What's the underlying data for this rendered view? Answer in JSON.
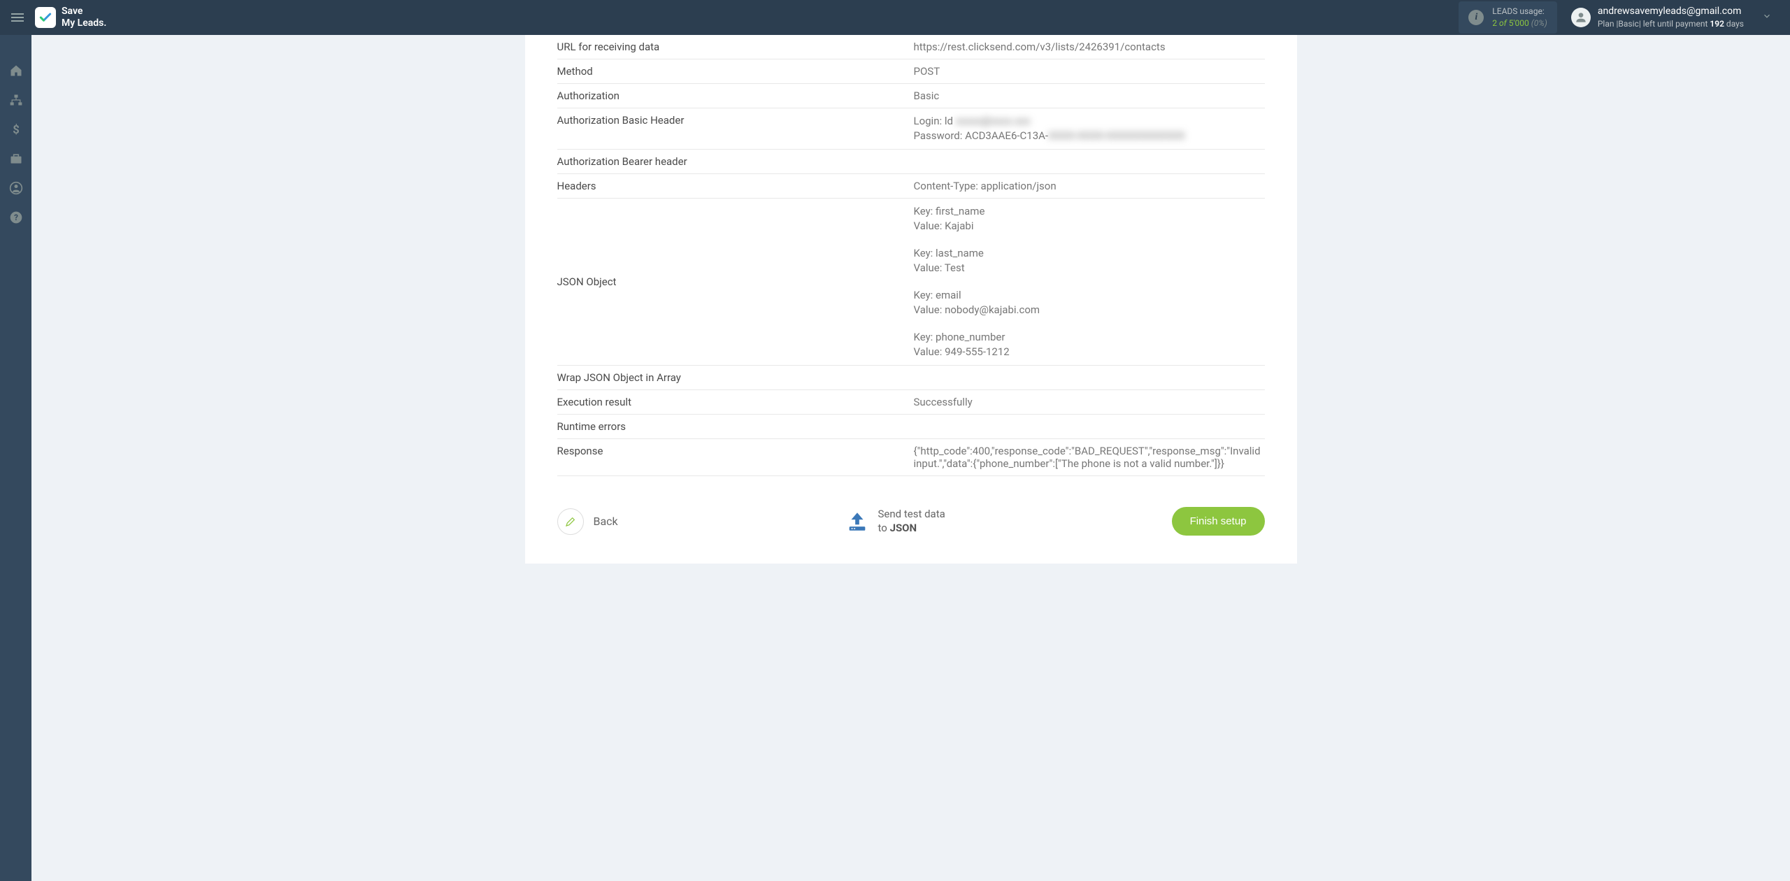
{
  "header": {
    "brand_line1": "Save",
    "brand_line2": "My Leads.",
    "leads": {
      "label": "LEADS usage:",
      "used": "2",
      "of": "of",
      "total": "5'000",
      "pct": "(0%)"
    },
    "user": {
      "email": "andrewsavemyleads@gmail.com",
      "plan_prefix": "Plan |",
      "plan_name": "Basic",
      "plan_mid": "| left until payment",
      "days_num": "192",
      "days_label": "days"
    }
  },
  "rows": {
    "url_label": "URL for receiving data",
    "url_value": "https://rest.clicksend.com/v3/lists/2426391/contacts",
    "method_label": "Method",
    "method_value": "POST",
    "auth_label": "Authorization",
    "auth_value": "Basic",
    "basic_header_label": "Authorization Basic Header",
    "login_prefix": "Login: ld",
    "login_blur": "xxxxx@xxxx.xxx",
    "pw_prefix": "Password: ACD3AAE6-C13A-",
    "pw_blur": "XXXX-XXXX-XXXXXXXXXXXX",
    "bearer_label": "Authorization Bearer header",
    "headers_label": "Headers",
    "headers_value": "Content-Type: application/json",
    "json_label": "JSON Object",
    "json": [
      {
        "key": "Key: first_name",
        "value": "Value: Kajabi"
      },
      {
        "key": "Key: last_name",
        "value": "Value: Test"
      },
      {
        "key": "Key: email",
        "value": "Value: nobody@kajabi.com"
      },
      {
        "key": "Key: phone_number",
        "value": "Value: 949-555-1212"
      }
    ],
    "wrap_label": "Wrap JSON Object in Array",
    "exec_label": "Execution result",
    "exec_value": "Successfully",
    "runtime_label": "Runtime errors",
    "response_label": "Response",
    "response_value": "{\"http_code\":400,\"response_code\":\"BAD_REQUEST\",\"response_msg\":\"Invalid input.\",\"data\":{\"phone_number\":[\"The phone is not a valid number.\"]}}"
  },
  "actions": {
    "back": "Back",
    "send_line1": "Send test data",
    "send_line2_prefix": "to ",
    "send_line2_bold": "JSON",
    "finish": "Finish setup"
  }
}
